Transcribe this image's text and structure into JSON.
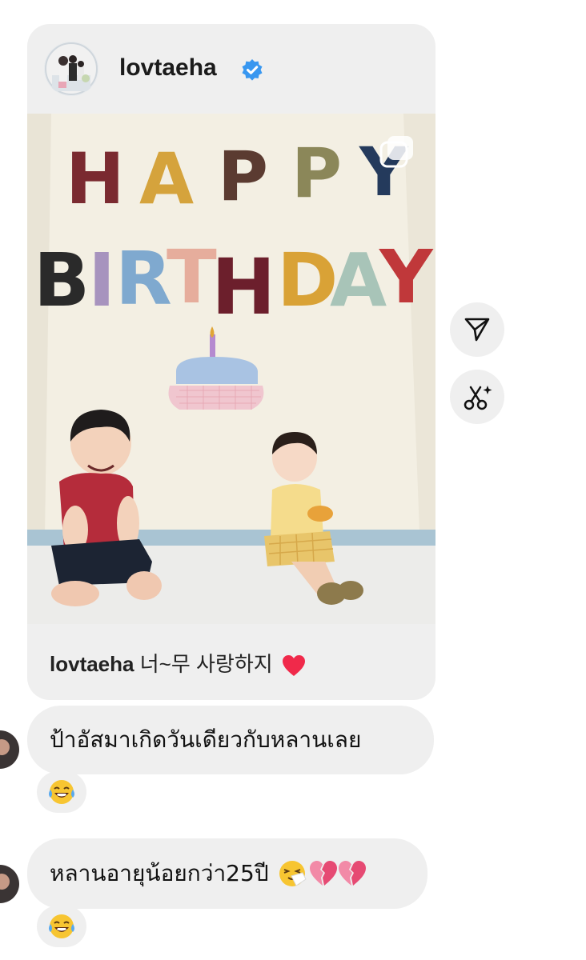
{
  "post": {
    "username": "lovtaeha",
    "verified": true,
    "caption_user": "lovtaeha",
    "caption_text": "너~무 사랑하지",
    "caption_emoji": "red-heart",
    "photo": {
      "banner_line1": "HAPPY",
      "banner_line2": "BIRTHDAY"
    }
  },
  "side_actions": [
    {
      "name": "share",
      "icon": "paper-plane-icon"
    },
    {
      "name": "remix",
      "icon": "scissors-sparkle-icon"
    }
  ],
  "messages": [
    {
      "text": "ป้าอัสมาเกิดวันเดียวกับหลานเลย",
      "emojis": [],
      "reaction": "face-with-tears-of-joy"
    },
    {
      "text": "หลานอายุน้อยกว่า25ปี",
      "emojis": [
        "sneezing-face",
        "broken-heart",
        "broken-heart"
      ],
      "reaction": "face-with-tears-of-joy"
    }
  ],
  "colors": {
    "bubble_bg": "#efefef",
    "verified_blue": "#3897f0",
    "heart_red": "#f0294a"
  }
}
